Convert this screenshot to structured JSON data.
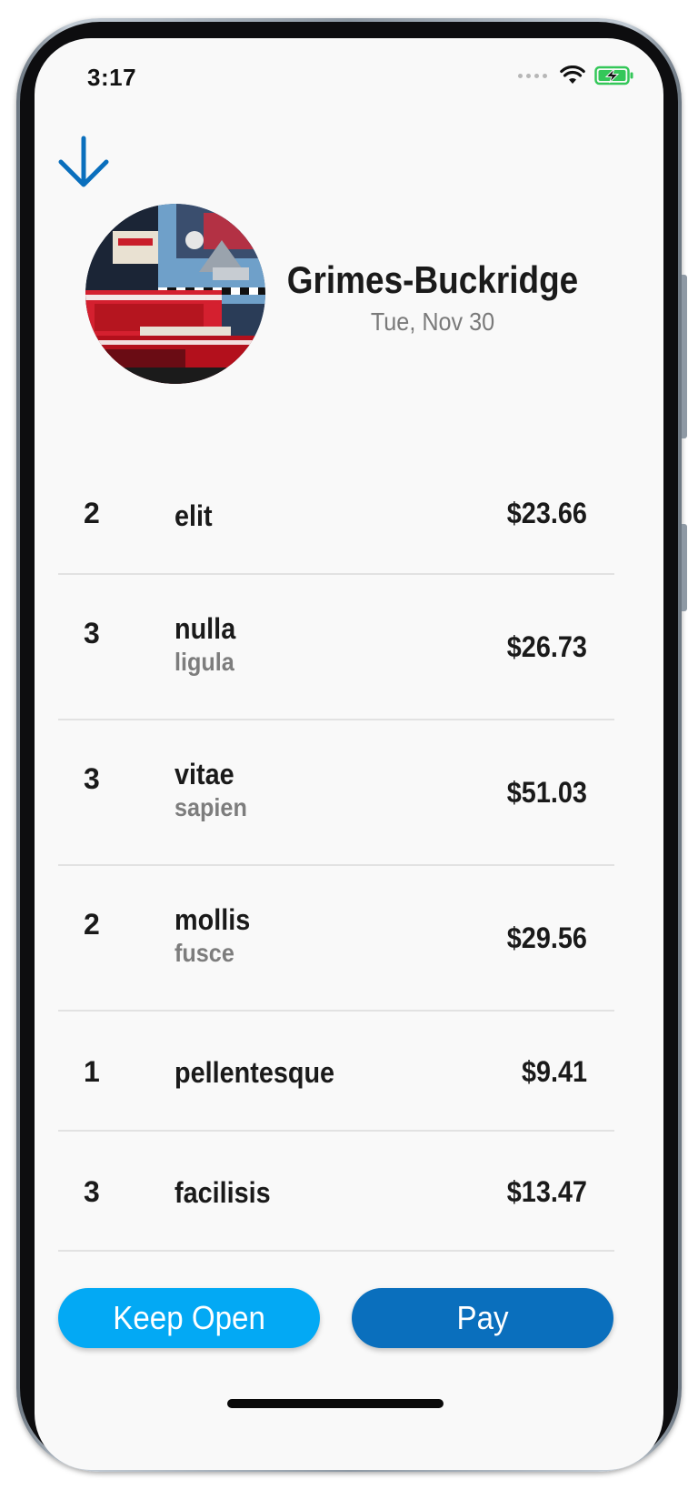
{
  "status_bar": {
    "time": "3:17"
  },
  "header": {
    "back_icon": "arrow-down-icon",
    "restaurant_name": "Grimes-Buckridge",
    "date": "Tue, Nov 30"
  },
  "items": [
    {
      "qty": "2",
      "name": "elit",
      "note": "",
      "price": "$23.66"
    },
    {
      "qty": "3",
      "name": "nulla",
      "note": "ligula",
      "price": "$26.73"
    },
    {
      "qty": "3",
      "name": "vitae",
      "note": "sapien",
      "price": "$51.03"
    },
    {
      "qty": "2",
      "name": "mollis",
      "note": "fusce",
      "price": "$29.56"
    },
    {
      "qty": "1",
      "name": "pellentesque",
      "note": "",
      "price": "$9.41"
    },
    {
      "qty": "3",
      "name": "facilisis",
      "note": "",
      "price": "$13.47"
    }
  ],
  "actions": {
    "keep_open_label": "Keep Open",
    "pay_label": "Pay"
  },
  "colors": {
    "accent_light": "#03a9f4",
    "accent_dark": "#0a6fbd",
    "back_arrow": "#0a6fbd",
    "battery": "#34c759"
  }
}
